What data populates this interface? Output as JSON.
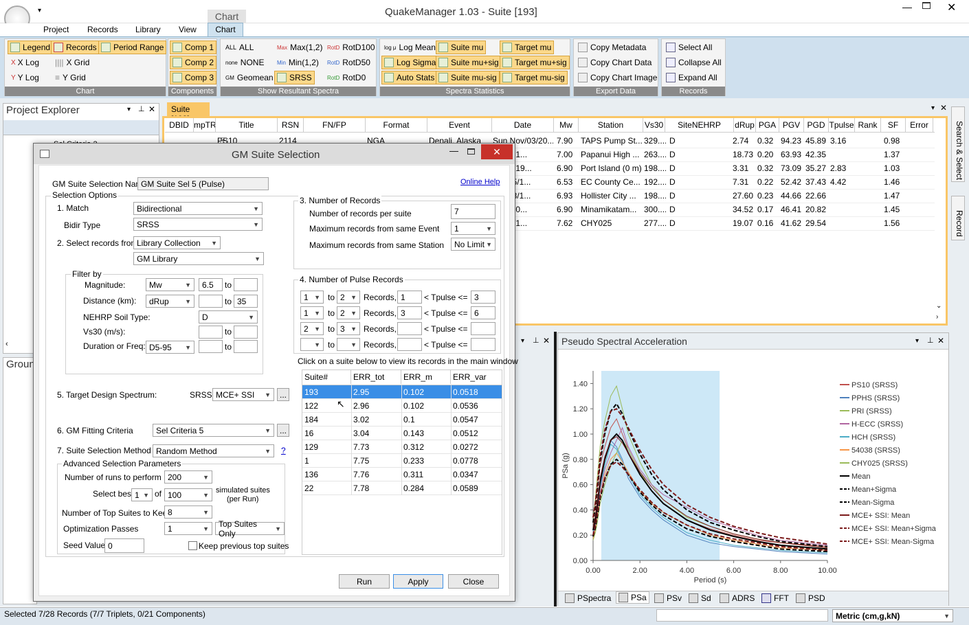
{
  "app": {
    "title": "QuakeManager 1.03 - Suite [193]",
    "context_tab": "Chart",
    "menu": [
      "Project",
      "Records",
      "Library",
      "View",
      "Chart"
    ]
  },
  "ribbon": {
    "chart_group": {
      "label": "Chart",
      "legend": "Legend",
      "records": "Records",
      "period_range": "Period Range",
      "xlog": "X Log",
      "xgrid": "X Grid",
      "ylog": "Y Log",
      "ygrid": "Y Grid"
    },
    "components_group": {
      "label": "Components",
      "comp1": "Comp 1",
      "comp2": "Comp 2",
      "comp3": "Comp 3"
    },
    "resultant_group": {
      "label": "Show Resultant Spectra",
      "all": "ALL",
      "none": "NONE",
      "geomean": "Geomean",
      "max12": "Max(1,2)",
      "min12": "Min(1,2)",
      "srss": "SRSS",
      "rotd100": "RotD100",
      "rotd50": "RotD50",
      "rotd0": "RotD0"
    },
    "stats_group": {
      "label": "Spectra Statistics",
      "log_mean": "Log Mean",
      "log_sigma": "Log Sigma",
      "auto_stats": "Auto Stats",
      "suite_mu": "Suite mu",
      "suite_mu_sig": "Suite mu+sig",
      "suite_mu_minus_sig": "Suite mu-sig",
      "target_mu": "Target mu",
      "target_mu_sig": "Target mu+sig",
      "target_mu_minus_sig": "Target mu-sig"
    },
    "export_group": {
      "label": "Export Data",
      "copy_metadata": "Copy Metadata",
      "copy_chart_data": "Copy Chart Data",
      "copy_chart_image": "Copy Chart Image"
    },
    "records_group": {
      "label": "Records",
      "select_all": "Select All",
      "collapse_all": "Collapse All",
      "expand_all": "Expand All"
    }
  },
  "explorer": {
    "title": "Project Explorer",
    "item": "Sel Criteria 2",
    "ground_title": "Groun"
  },
  "suite_tab": {
    "label": "Suite [193]",
    "columns": [
      "DBID",
      "mpTR",
      "Title",
      "RSN",
      "FN/FP",
      "Format",
      "Event",
      "Date",
      "Mw",
      "Station",
      "Vs30",
      "SiteNEHRP",
      "dRup",
      "PGA",
      "PGV",
      "PGD",
      "Tpulse",
      "Rank",
      "SF",
      "Error"
    ],
    "rows": [
      {
        "title": "PS10",
        "rsn": "2114",
        "format": "NGA",
        "event": "Denali, Alaska",
        "date": "Sun Nov/03/20...",
        "mw": "7.90",
        "station": "TAPS Pump St...",
        "vs30": "329....",
        "site": "D",
        "drup": "2.74",
        "pga": "0.32",
        "pgv": "94.23",
        "pgd": "45.89",
        "tpulse": "3.16",
        "sf": "0.98"
      },
      {
        "date": "/03/201...",
        "mw": "7.00",
        "station": "Papanui High ...",
        "vs30": "263....",
        "site": "D",
        "drup": "18.73",
        "pga": "0.20",
        "pgv": "63.93",
        "pgd": "42.35",
        "tpulse": "",
        "sf": "1.37"
      },
      {
        "date": "an/16/19...",
        "mw": "6.90",
        "station": "Port Island (0 m)",
        "vs30": "198....",
        "site": "D",
        "drup": "3.31",
        "pga": "0.32",
        "pgv": "73.09",
        "pgd": "35.27",
        "tpulse": "2.83",
        "sf": "1.03"
      },
      {
        "date": "Oct/15/1...",
        "mw": "6.53",
        "station": "EC County Ce...",
        "vs30": "192....",
        "site": "D",
        "drup": "7.31",
        "pga": "0.22",
        "pgv": "52.42",
        "pgd": "37.43",
        "tpulse": "4.42",
        "sf": "1.46"
      },
      {
        "date": "Oct/18/1...",
        "mw": "6.93",
        "station": "Hollister City ...",
        "vs30": "198....",
        "site": "D",
        "drup": "27.60",
        "pga": "0.23",
        "pgv": "44.66",
        "pgd": "22.66",
        "tpulse": "",
        "sf": "1.47"
      },
      {
        "date": "/13/200...",
        "mw": "6.90",
        "station": "Minamikatam...",
        "vs30": "300....",
        "site": "D",
        "drup": "34.52",
        "pga": "0.17",
        "pgv": "46.41",
        "pgd": "20.82",
        "tpulse": "",
        "sf": "1.45"
      },
      {
        "date": "ep/20/1...",
        "mw": "7.62",
        "station": "CHY025",
        "vs30": "277....",
        "site": "D",
        "drup": "19.07",
        "pga": "0.16",
        "pgv": "41.62",
        "pgd": "29.54",
        "tpulse": "",
        "sf": "1.56"
      }
    ]
  },
  "dialog": {
    "title": "GM Suite Selection",
    "name_label": "GM Suite Selection Name:",
    "name_value": "GM Suite Sel 5 (Pulse)",
    "online_help": "Online Help",
    "selection_options": "Selection Options",
    "match_label": "1. Match",
    "match_value": "Bidirectional",
    "bidir_label": "Bidir Type",
    "bidir_value": "SRSS",
    "select_from_label": "2. Select records from",
    "select_from_value": "Library Collection",
    "library_value": "GM Library",
    "filter_by": "Filter by",
    "magnitude": "Magnitude:",
    "mag_type": "Mw",
    "mag_min": "6.5",
    "mag_max": "",
    "to": "to",
    "distance": "Distance (km):",
    "dist_type": "dRup",
    "dist_min": "",
    "dist_max": "35",
    "nehrp": "NEHRP Soil Type:",
    "nehrp_value": "D",
    "vs30": "Vs30 (m/s):",
    "duration": "Duration or Freq:",
    "dur_type": "D5-95",
    "num_records": "3. Number of Records",
    "per_suite_label": "Number of records per suite",
    "per_suite": "7",
    "max_event_label": "Maximum records from same Event",
    "max_event": "1",
    "max_station_label": "Maximum records from same Station",
    "max_station": "No Limit",
    "pulse_title": "4. Number of Pulse Records",
    "records_word": "Records,",
    "tpulse_le": "< Tpulse <=",
    "pulse_rows": [
      {
        "a": "1",
        "b": "2",
        "lo": "1",
        "hi": "3"
      },
      {
        "a": "1",
        "b": "2",
        "lo": "3",
        "hi": "6"
      },
      {
        "a": "2",
        "b": "3",
        "lo": "",
        "hi": ""
      },
      {
        "a": "",
        "b": "",
        "lo": "",
        "hi": ""
      }
    ],
    "click_hint": "Click on a suite below to view its records in the main window",
    "suite_cols": [
      "Suite#",
      "ERR_tot",
      "ERR_m",
      "ERR_var"
    ],
    "suites": [
      [
        "193",
        "2.95",
        "0.102",
        "0.0518"
      ],
      [
        "122",
        "2.96",
        "0.102",
        "0.0536"
      ],
      [
        "184",
        "3.02",
        "0.1",
        "0.0547"
      ],
      [
        "16",
        "3.04",
        "0.143",
        "0.0512"
      ],
      [
        "129",
        "7.73",
        "0.312",
        "0.0272"
      ],
      [
        "1",
        "7.75",
        "0.233",
        "0.0778"
      ],
      [
        "136",
        "7.76",
        "0.311",
        "0.0347"
      ],
      [
        "22",
        "7.78",
        "0.284",
        "0.0589"
      ]
    ],
    "target_label": "5. Target Design Spectrum:",
    "target_type": "SRSS",
    "target_value": "MCE+ SSI",
    "ellipsis": "...",
    "fitting_label": "6. GM Fitting Criteria",
    "fitting_value": "Sel Criteria 5",
    "method_label": "7. Suite Selection Method",
    "method_value": "Random Method",
    "qmark": "?",
    "adv_title": "Advanced Selection Parameters",
    "runs_label": "Number of runs to perform",
    "runs": "200",
    "best_label": "Select best",
    "best": "1",
    "of": "of",
    "of_value": "100",
    "sim_label": "simulated suites",
    "per_run": "(per Run)",
    "top_label": "Number of Top Suites to Keep",
    "top": "8",
    "passes_label": "Optimization Passes",
    "passes": "1",
    "passes_mode": "Top Suites Only",
    "seed_label": "Seed Value",
    "seed": "0",
    "keep_prev": "Keep previous top suites",
    "run": "Run",
    "apply": "Apply",
    "close": "Close"
  },
  "psa": {
    "title": "Pseudo Spectral Acceleration",
    "tabs": [
      "PSpectra",
      "PSa",
      "PSv",
      "Sd",
      "ADRS",
      "FFT",
      "PSD"
    ]
  },
  "side_tabs": {
    "search": "Search & Select",
    "record": "Record"
  },
  "status": {
    "text": "Selected 7/28 Records (7/7 Triplets, 0/21 Components)",
    "units": "Metric (cm,g,kN)"
  },
  "chart_data": {
    "type": "line",
    "title": "Pseudo Spectral Acceleration",
    "xlabel": "Period (s)",
    "ylabel": "PSa (g)",
    "xlim": [
      0,
      10
    ],
    "ylim": [
      0,
      1.5
    ],
    "xticks": [
      "0.00",
      "2.00",
      "4.00",
      "6.00",
      "8.00",
      "10.00"
    ],
    "yticks": [
      "0.00",
      "0.20",
      "0.40",
      "0.60",
      "0.80",
      "1.00",
      "1.20",
      "1.40"
    ],
    "period_range": [
      0.35,
      5.4
    ],
    "legend_position": "right",
    "x": [
      0,
      0.1,
      0.2,
      0.3,
      0.5,
      0.75,
      1,
      1.25,
      1.5,
      2,
      2.5,
      3,
      4,
      5,
      6,
      7,
      8,
      10
    ],
    "series": [
      {
        "name": "PS10 (SRSS)",
        "color": "#c0504d",
        "style": "solid",
        "values": [
          0.32,
          0.45,
          0.6,
          0.75,
          0.9,
          1.05,
          1.12,
          1.0,
          0.88,
          0.7,
          0.55,
          0.45,
          0.32,
          0.25,
          0.2,
          0.16,
          0.14,
          0.11
        ]
      },
      {
        "name": "PPHS (SRSS)",
        "color": "#4f81bd",
        "style": "solid",
        "values": [
          0.2,
          0.3,
          0.45,
          0.6,
          0.8,
          0.95,
          0.9,
          0.8,
          0.65,
          0.5,
          0.4,
          0.32,
          0.2,
          0.14,
          0.11,
          0.09,
          0.07,
          0.05
        ]
      },
      {
        "name": "PRI (SRSS)",
        "color": "#9bbb59",
        "style": "solid",
        "values": [
          0.32,
          0.5,
          0.7,
          0.9,
          1.1,
          1.3,
          1.38,
          1.2,
          1.0,
          0.78,
          0.6,
          0.48,
          0.34,
          0.27,
          0.21,
          0.17,
          0.14,
          0.1
        ]
      },
      {
        "name": "H-ECC (SRSS)",
        "color": "#b065a0",
        "style": "solid",
        "values": [
          0.22,
          0.3,
          0.42,
          0.55,
          0.72,
          0.85,
          0.95,
          1.05,
          0.9,
          0.72,
          0.6,
          0.52,
          0.42,
          0.32,
          0.26,
          0.2,
          0.16,
          0.12
        ]
      },
      {
        "name": "HCH (SRSS)",
        "color": "#4bacc6",
        "style": "solid",
        "values": [
          0.23,
          0.32,
          0.45,
          0.58,
          0.75,
          0.92,
          0.88,
          0.78,
          0.68,
          0.52,
          0.42,
          0.34,
          0.22,
          0.16,
          0.12,
          0.1,
          0.08,
          0.06
        ]
      },
      {
        "name": "54038 (SRSS)",
        "color": "#f79646",
        "style": "solid",
        "values": [
          0.17,
          0.25,
          0.38,
          0.5,
          0.68,
          0.8,
          0.85,
          0.78,
          0.7,
          0.55,
          0.45,
          0.38,
          0.28,
          0.2,
          0.16,
          0.13,
          0.1,
          0.08
        ]
      },
      {
        "name": "CHY025 (SRSS)",
        "color": "#9bbb59",
        "style": "solid",
        "values": [
          0.16,
          0.22,
          0.32,
          0.45,
          0.6,
          0.75,
          0.85,
          0.95,
          0.88,
          0.7,
          0.55,
          0.45,
          0.32,
          0.24,
          0.19,
          0.15,
          0.12,
          0.09
        ]
      },
      {
        "name": "Mean",
        "color": "#000000",
        "style": "solid",
        "values": [
          0.24,
          0.33,
          0.47,
          0.62,
          0.8,
          0.95,
          1.0,
          0.95,
          0.85,
          0.68,
          0.55,
          0.45,
          0.32,
          0.24,
          0.19,
          0.15,
          0.12,
          0.09
        ]
      },
      {
        "name": "Mean+Sigma",
        "color": "#000000",
        "style": "dash",
        "values": [
          0.3,
          0.42,
          0.58,
          0.78,
          1.0,
          1.18,
          1.24,
          1.16,
          1.04,
          0.84,
          0.68,
          0.56,
          0.4,
          0.3,
          0.24,
          0.19,
          0.15,
          0.11
        ]
      },
      {
        "name": "Mean-Sigma",
        "color": "#000000",
        "style": "dash",
        "values": [
          0.19,
          0.26,
          0.37,
          0.49,
          0.64,
          0.76,
          0.8,
          0.76,
          0.68,
          0.54,
          0.44,
          0.36,
          0.25,
          0.19,
          0.15,
          0.12,
          0.09,
          0.07
        ]
      },
      {
        "name": "MCE+ SSI: Mean",
        "color": "#7b1a1a",
        "style": "solid",
        "values": [
          0.26,
          0.36,
          0.5,
          0.65,
          0.82,
          0.95,
          0.98,
          0.93,
          0.85,
          0.7,
          0.58,
          0.48,
          0.35,
          0.27,
          0.21,
          0.17,
          0.14,
          0.1
        ]
      },
      {
        "name": "MCE+ SSI: Mean+Sigma",
        "color": "#7b1a1a",
        "style": "dash",
        "values": [
          0.34,
          0.46,
          0.63,
          0.82,
          1.03,
          1.18,
          1.2,
          1.14,
          1.05,
          0.87,
          0.72,
          0.6,
          0.44,
          0.34,
          0.27,
          0.22,
          0.18,
          0.13
        ]
      },
      {
        "name": "MCE+ SSI: Mean-Sigma",
        "color": "#7b1a1a",
        "style": "dash",
        "values": [
          0.2,
          0.28,
          0.39,
          0.51,
          0.65,
          0.75,
          0.78,
          0.74,
          0.68,
          0.56,
          0.46,
          0.38,
          0.28,
          0.21,
          0.17,
          0.14,
          0.11,
          0.08
        ]
      }
    ]
  }
}
